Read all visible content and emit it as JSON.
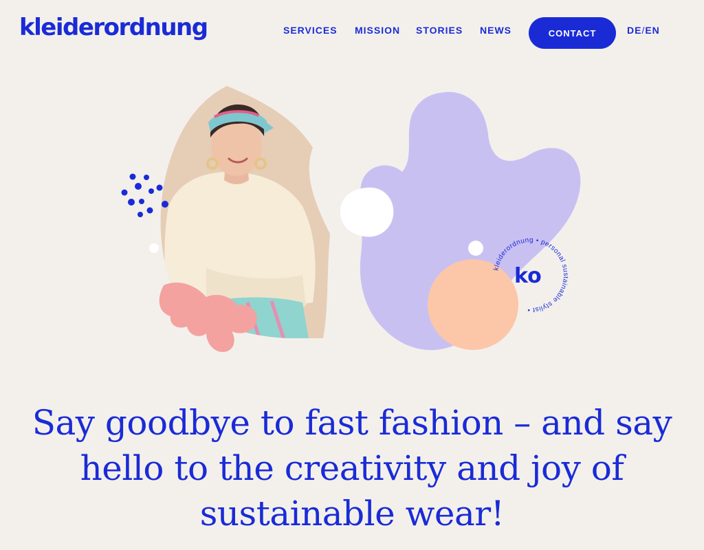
{
  "header": {
    "logo_text": "kleiderordnung",
    "nav": {
      "services": "SERVICES",
      "mission": "MISSION",
      "stories": "STORIES",
      "news": "NEWS"
    },
    "contact_label": "CONTACT",
    "lang": {
      "de": "DE",
      "separator": "/",
      "en": "EN"
    }
  },
  "badge": {
    "monogram": "ko",
    "ring_text": "kleiderordnung • personal sustainable stylist •"
  },
  "hero": {
    "headline": "Say goodbye to fast fashion – and say hello to the creativity and joy of sustainable wear!"
  },
  "colors": {
    "brand_blue": "#1a2bd6",
    "background": "#f3f0ec",
    "lavender": "#c9c0f2",
    "peach": "#fcc7a8",
    "coral": "#f4a29f",
    "beige_bg": "#e9d3bf"
  },
  "icons": {
    "leaf": "leaf-icon",
    "dots": "dot-cluster-decoration"
  }
}
